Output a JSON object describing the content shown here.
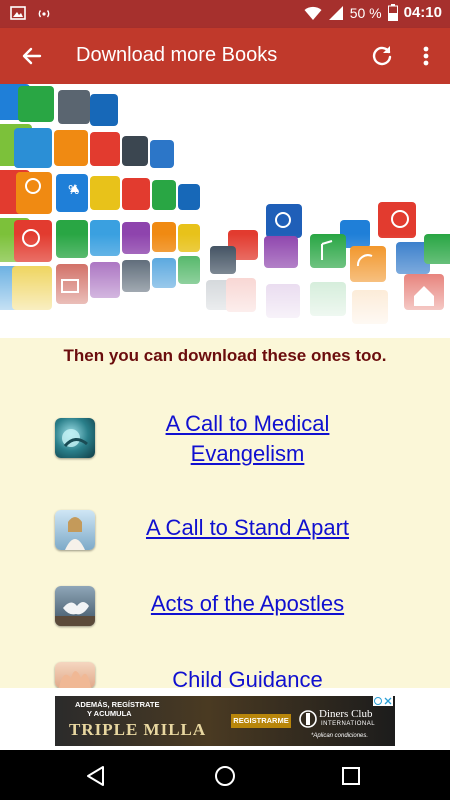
{
  "status_bar": {
    "battery": "50 %",
    "time": "04:10"
  },
  "app_bar": {
    "title": "Download more Books"
  },
  "intro": {
    "text": "Then you can download these ones too."
  },
  "books": [
    {
      "title_line1": "A Call to Medical",
      "title_line2": "Evangelism"
    },
    {
      "title": "A Call to Stand Apart"
    },
    {
      "title": "Acts of the Apostles"
    },
    {
      "title": "Child Guidance"
    }
  ],
  "ad": {
    "line1": "ADEMÁS, REGÍSTRATE",
    "line2": "Y ACUMULA",
    "headline": "TRIPLE MILLA",
    "button": "REGISTRARME",
    "brand": "Diners Club",
    "brand_sub": "INTERNATIONAL",
    "disclaimer": "*Aplican condiciones."
  },
  "colors": {
    "app_bar": "#c0392b",
    "status_bar": "#a6302d",
    "background": "#fbf7d8",
    "link": "#1010d0",
    "intro_text": "#6b0d0d"
  }
}
